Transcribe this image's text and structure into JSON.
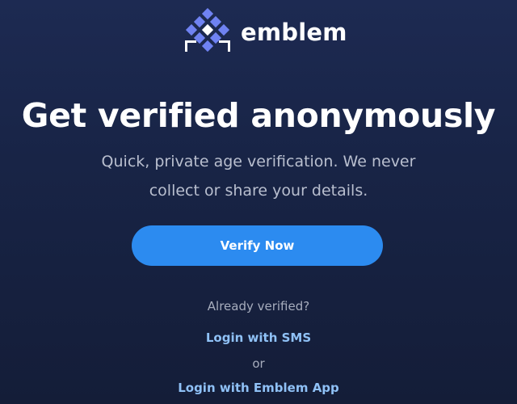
{
  "brand": {
    "name": "emblem",
    "logo_icon": "emblem-logo-icon",
    "logo_colors": [
      "#6d7ff0",
      "#ffffff"
    ]
  },
  "hero": {
    "headline": "Get verified anonymously",
    "subtitle_line1": "Quick, private age verification. We never",
    "subtitle_line2": "collect or share your details."
  },
  "actions": {
    "verify_label": "Verify Now",
    "already_verified_text": "Already verified?",
    "login_sms_label": "Login with SMS",
    "or_text": "or",
    "login_app_label": "Login with Emblem App"
  },
  "colors": {
    "background": "#1b2749",
    "primary_button": "#2c8bf0",
    "link": "#8fc1f6",
    "muted_text": "#a7adbd"
  }
}
